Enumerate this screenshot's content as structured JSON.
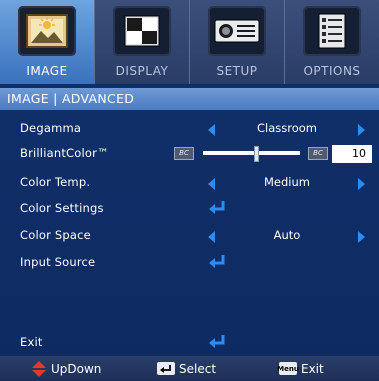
{
  "tabs": [
    {
      "label": "IMAGE",
      "icon": "image-icon",
      "active": true
    },
    {
      "label": "DISPLAY",
      "icon": "display-icon",
      "active": false
    },
    {
      "label": "SETUP",
      "icon": "setup-icon",
      "active": false
    },
    {
      "label": "OPTIONS",
      "icon": "options-icon",
      "active": false
    }
  ],
  "breadcrumb": "IMAGE | ADVANCED",
  "menu": {
    "degamma": {
      "label": "Degamma",
      "value": "Classroom"
    },
    "brilliantcolor": {
      "label": "BrilliantColor™",
      "value": "10",
      "level_fraction": 0.55,
      "min_icon_text": "BC",
      "max_icon_text": "BC"
    },
    "color_temp": {
      "label": "Color Temp.",
      "value": "Medium"
    },
    "color_settings": {
      "label": "Color Settings"
    },
    "color_space": {
      "label": "Color Space",
      "value": "Auto"
    },
    "input_source": {
      "label": "Input Source"
    },
    "exit": {
      "label": "Exit"
    }
  },
  "footer": {
    "updown": "UpDown",
    "select": "Select",
    "menu_key": "Menu",
    "exit": "Exit"
  },
  "colors": {
    "accent_arrow": "#2f8bf0",
    "enter_icon": "#2f8bf0",
    "updown_icon": "#e23a2a",
    "active_tab": "#5a92d6"
  }
}
